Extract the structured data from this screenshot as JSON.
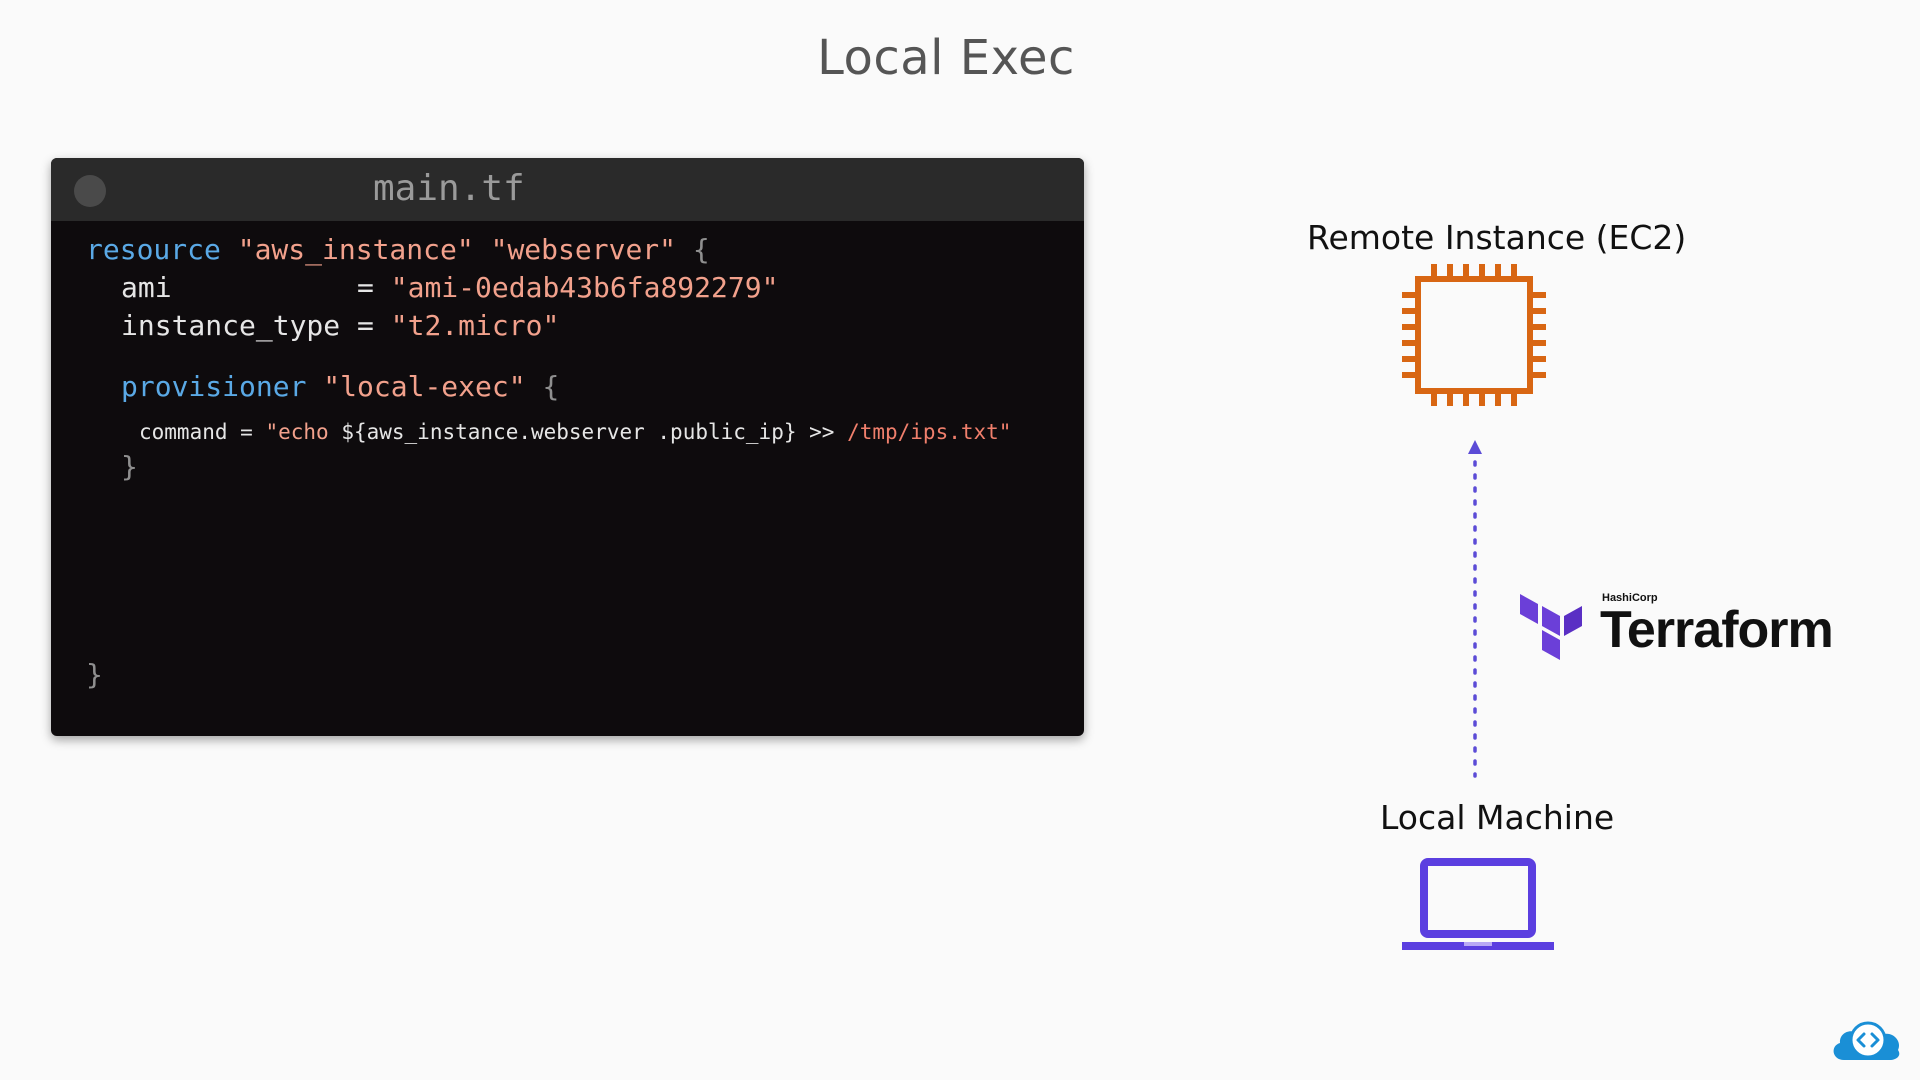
{
  "slide": {
    "title": "Local Exec"
  },
  "code_window": {
    "file_name": "main.tf",
    "lines": {
      "l1": {
        "kw": "resource",
        "s1": "\"aws_instance\"",
        "s2": "\"webserver\"",
        "brace": "{"
      },
      "l2": {
        "key": "ami",
        "eq": "=",
        "val": "\"ami-0edab43b6fa892279\""
      },
      "l3": {
        "key": "instance_type",
        "eq": "=",
        "val": "\"t2.micro\""
      },
      "l4": {
        "kw": "provisioner",
        "s1": "\"local-exec\"",
        "brace": "{"
      },
      "l5": {
        "key": "command =",
        "s_echo": "\"echo",
        "interp": "${aws_instance.webserver .public_ip} >>",
        "path": "/tmp/ips.txt\""
      },
      "l6": {
        "brace": "}"
      },
      "l7": {
        "brace": "}"
      }
    }
  },
  "diagram": {
    "remote_label": "Remote Instance (EC2)",
    "local_label": "Local Machine",
    "terraform_brand": "Terraform",
    "hashicorp_label": "HashiCorp",
    "colors": {
      "ec2": "#d86613",
      "arrow": "#5b4bd6",
      "laptop": "#5b3fe0",
      "terraform": "#6b3fd8"
    }
  },
  "icons": {
    "ec2": "ec2-chip-icon",
    "laptop": "laptop-icon",
    "terraform": "terraform-logo-icon",
    "brand": "cloud-code-logo-icon"
  }
}
